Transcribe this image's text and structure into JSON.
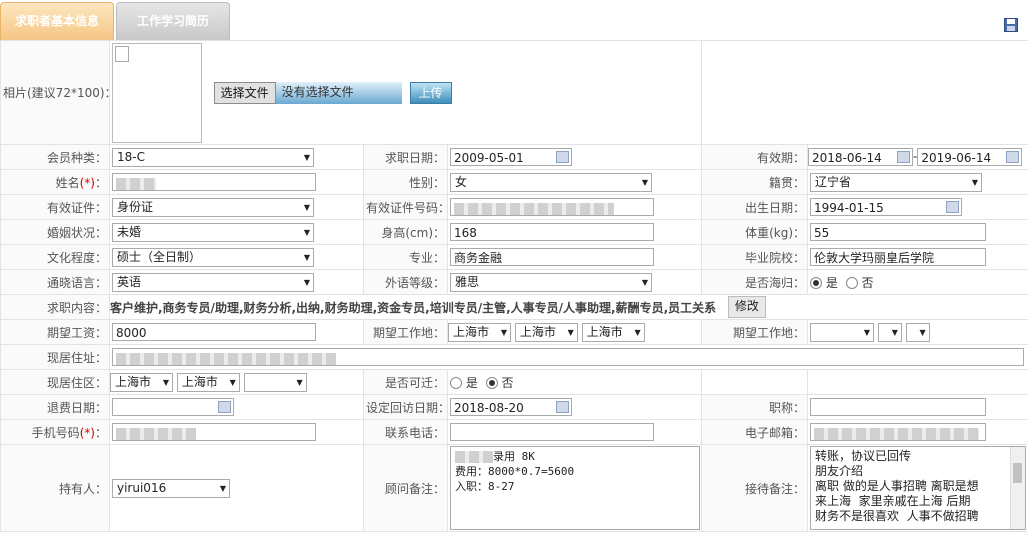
{
  "tabs": [
    {
      "label": "求职者基本信息"
    },
    {
      "label": "工作学习简历"
    }
  ],
  "labels": {
    "photo": "相片(建议72*100)：",
    "member_type": "会员种类：",
    "apply_date": "求职日期：",
    "validity": "有效期：",
    "name": "姓名",
    "gender": "性别：",
    "native_place": "籍贯：",
    "id_type": "有效证件：",
    "id_number": "有效证件号码：",
    "birth_date": "出生日期：",
    "marital": "婚姻状况：",
    "height": "身高(cm)：",
    "weight": "体重(kg)：",
    "education": "文化程度：",
    "major": "专业：",
    "school": "毕业院校：",
    "language": "通晓语言：",
    "foreign_level": "外语等级：",
    "returnee": "是否海归：",
    "job_content": "求职内容：",
    "expected_salary": "期望工资：",
    "expected_location": "期望工作地：",
    "expected_location2": "期望工作地：",
    "address": "现居住址：",
    "district": "现居住区：",
    "relocate": "是否可迁：",
    "refund_date": "退费日期：",
    "revisit_date": "设定回访日期：",
    "job_title": "职称：",
    "mobile": "手机号码",
    "phone": "联系电话：",
    "email": "电子邮箱：",
    "holder": "持有人：",
    "consultant_note": "顾问备注：",
    "receive_note": "接待备注："
  },
  "required_mark": "(*)",
  "upload": {
    "choose_file": "选择文件",
    "no_file": "没有选择文件",
    "upload_button": "上传"
  },
  "values": {
    "member_type": "18-C",
    "apply_date": "2009-05-01",
    "validity_start": "2018-06-14",
    "validity_sep": "-",
    "validity_end": "2019-06-14",
    "gender": "女",
    "native_place": "辽宁省",
    "id_type": "身份证",
    "birth_date": "1994-01-15",
    "marital": "未婚",
    "height": "168",
    "weight": "55",
    "education": "硕士（全日制）",
    "major": "商务金融",
    "school": "伦敦大学玛丽皇后学院",
    "language": "英语",
    "foreign_level": "雅思",
    "radio_yes": "是",
    "radio_no": "否",
    "job_content": "客户维护,商务专员/助理,财务分析,出纳,财务助理,资金专员,培训专员/主管,人事专员/人事助理,薪酬专员,员工关系",
    "modify_button": "修改",
    "expected_salary": "8000",
    "loc1": "上海市",
    "loc2": "上海市",
    "loc3": "上海市",
    "district1": "上海市",
    "district2": "上海市",
    "revisit_date": "2018-08-20",
    "holder": "yirui016",
    "consultant_note_l1": "录用 8K",
    "consultant_note_l2": "费用：8000*0.7=5600",
    "consultant_note_l3": "入职：8-27",
    "receive_note_l1": "转账，协议已回传",
    "receive_note_l2": "朋友介绍",
    "receive_note_l3": "离职 做的是人事招聘 离职是想",
    "receive_note_l4": "来上海  家里亲戚在上海 后期",
    "receive_note_l5": "财务不是很喜欢  人事不做招聘"
  }
}
